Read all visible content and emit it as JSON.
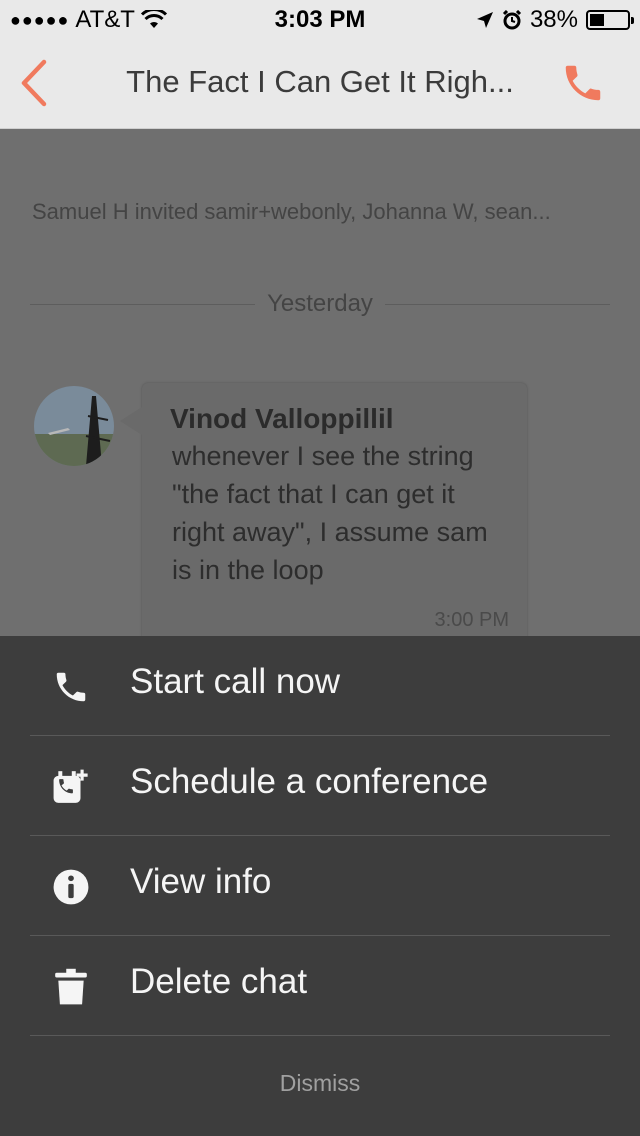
{
  "status_bar": {
    "carrier": "AT&T",
    "time": "3:03 PM",
    "battery": "38%",
    "battery_level": 0.38
  },
  "nav": {
    "title": "The Fact I Can Get It Righ...",
    "accent_color": "#f07a5e"
  },
  "conversation": {
    "system_message": "Samuel H invited samir+webonly, Johanna W, sean...",
    "date_divider": "Yesterday",
    "messages": [
      {
        "sender": "Vinod Valloppillil",
        "text": "whenever I see the string \"the fact that I can get it right away\", I assume sam is in the loop",
        "time": "3:00 PM"
      }
    ]
  },
  "action_sheet": {
    "items": [
      {
        "label": "Start call now",
        "icon": "phone-icon"
      },
      {
        "label": "Schedule a conference",
        "icon": "calendar-add-icon"
      },
      {
        "label": "View info",
        "icon": "info-icon"
      },
      {
        "label": "Delete chat",
        "icon": "trash-icon"
      }
    ],
    "dismiss": "Dismiss"
  }
}
